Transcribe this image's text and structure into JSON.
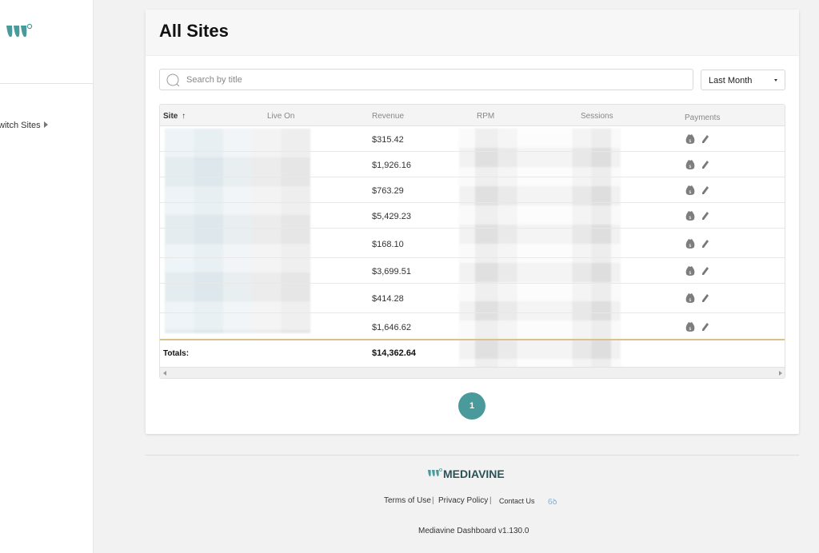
{
  "sidebar": {
    "switch_label": "witch Sites"
  },
  "card": {
    "title": "All Sites"
  },
  "search": {
    "placeholder": "Search by title",
    "value": ""
  },
  "date_filter": {
    "selected": "Last Month"
  },
  "table": {
    "columns": [
      "Site",
      "Live On",
      "Revenue",
      "RPM",
      "Sessions",
      "Payments"
    ],
    "sort_indicator": "↑",
    "rows": [
      {
        "revenue": "$315.42"
      },
      {
        "revenue": "$1,926.16"
      },
      {
        "revenue": "$763.29"
      },
      {
        "revenue": "$5,429.23"
      },
      {
        "revenue": "$168.10"
      },
      {
        "revenue": "$3,699.51"
      },
      {
        "revenue": "$414.28"
      },
      {
        "revenue": "$1,646.62"
      }
    ],
    "totals_label": "Totals:",
    "totals_revenue": "$14,362.64"
  },
  "pagination": {
    "current_page": "1"
  },
  "footer": {
    "brand": "MEDIAVINE",
    "links": [
      "Terms of Use",
      "Privacy Policy",
      "Contact Us"
    ],
    "separator": "|",
    "badge": "6ꝺ",
    "version": "Mediavine Dashboard v1.130.0"
  },
  "colors": {
    "accent": "#4a9a9c",
    "totals_rule": "#d8c28a",
    "brand_text": "#2a5358"
  }
}
